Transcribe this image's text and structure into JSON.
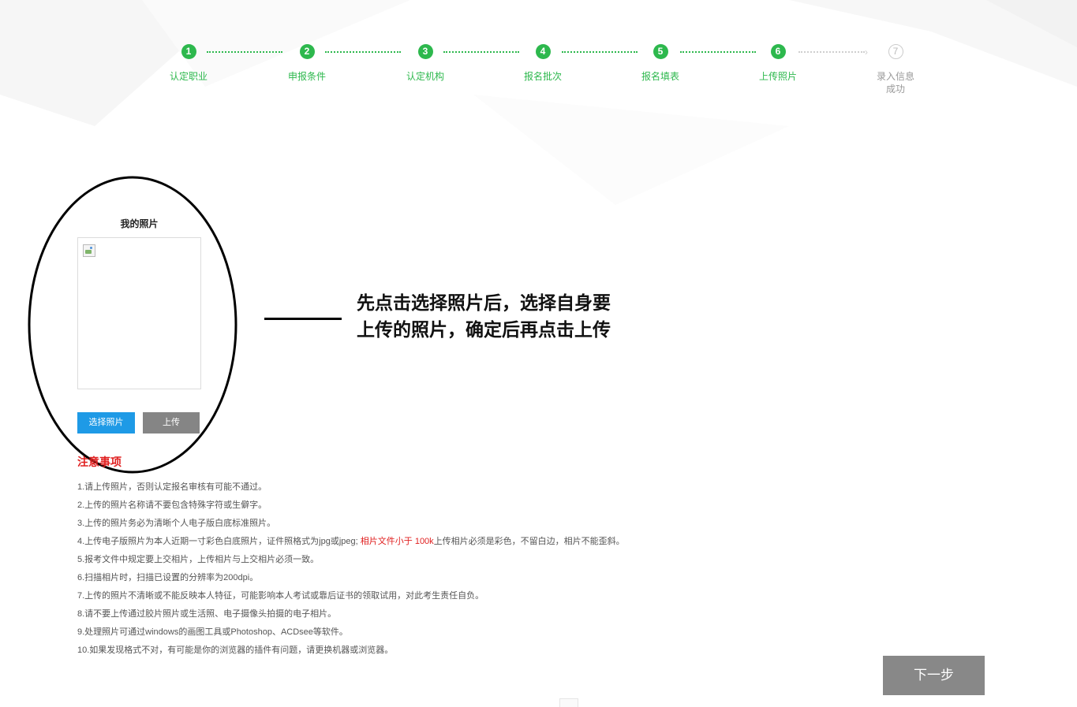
{
  "steps": [
    {
      "number": "1",
      "label": "认定职业",
      "state": "done"
    },
    {
      "number": "2",
      "label": "申报条件",
      "state": "done"
    },
    {
      "number": "3",
      "label": "认定机构",
      "state": "done"
    },
    {
      "number": "4",
      "label": "报名批次",
      "state": "done"
    },
    {
      "number": "5",
      "label": "报名填表",
      "state": "done"
    },
    {
      "number": "6",
      "label": "上传照片",
      "state": "current"
    },
    {
      "number": "7",
      "label": "录入信息成功",
      "label_line1": "录入信息",
      "label_line2": "成功",
      "state": "pending"
    }
  ],
  "photo": {
    "title": "我的照片",
    "select_button": "选择照片",
    "upload_button": "上传"
  },
  "annotation": {
    "line1": "先点击选择照片后，选择自身要",
    "line2": "上传的照片，确定后再点击上传"
  },
  "notices": {
    "title": "注意事项",
    "items": [
      "1.请上传照片，否则认定报名审核有可能不通过。",
      "2.上传的照片名称请不要包含特殊字符或生僻字。",
      "3.上传的照片务必为清晰个人电子版白底标准照片。",
      {
        "before": "4.上传电子版照片为本人近期一寸彩色白底照片，证件照格式为jpg或jpeg; ",
        "highlight": "相片文件小于 100k",
        "after": "上传相片必须是彩色，不留白边，相片不能歪斜。"
      },
      "5.报考文件中规定要上交相片，上传相片与上交相片必须一致。",
      "6.扫描相片时，扫描已设置的分辨率为200dpi。",
      "7.上传的照片不清晰或不能反映本人特征，可能影响本人考试或靠后证书的领取试用，对此考生责任自负。",
      "8.请不要上传通过胶片照片或生活照、电子摄像头拍摄的电子相片。",
      "9.处理照片可通过windows的画图工具或Photoshop、ACDsee等软件。",
      "10.如果发现格式不对，有可能是你的浏览器的插件有问题，请更换机器或浏览器。"
    ]
  },
  "next_button": "下一步",
  "colors": {
    "step_green": "#2db84d",
    "select_blue": "#1e9ae6",
    "upload_gray": "#858585",
    "notice_red": "#e02020",
    "next_gray": "#888888"
  }
}
